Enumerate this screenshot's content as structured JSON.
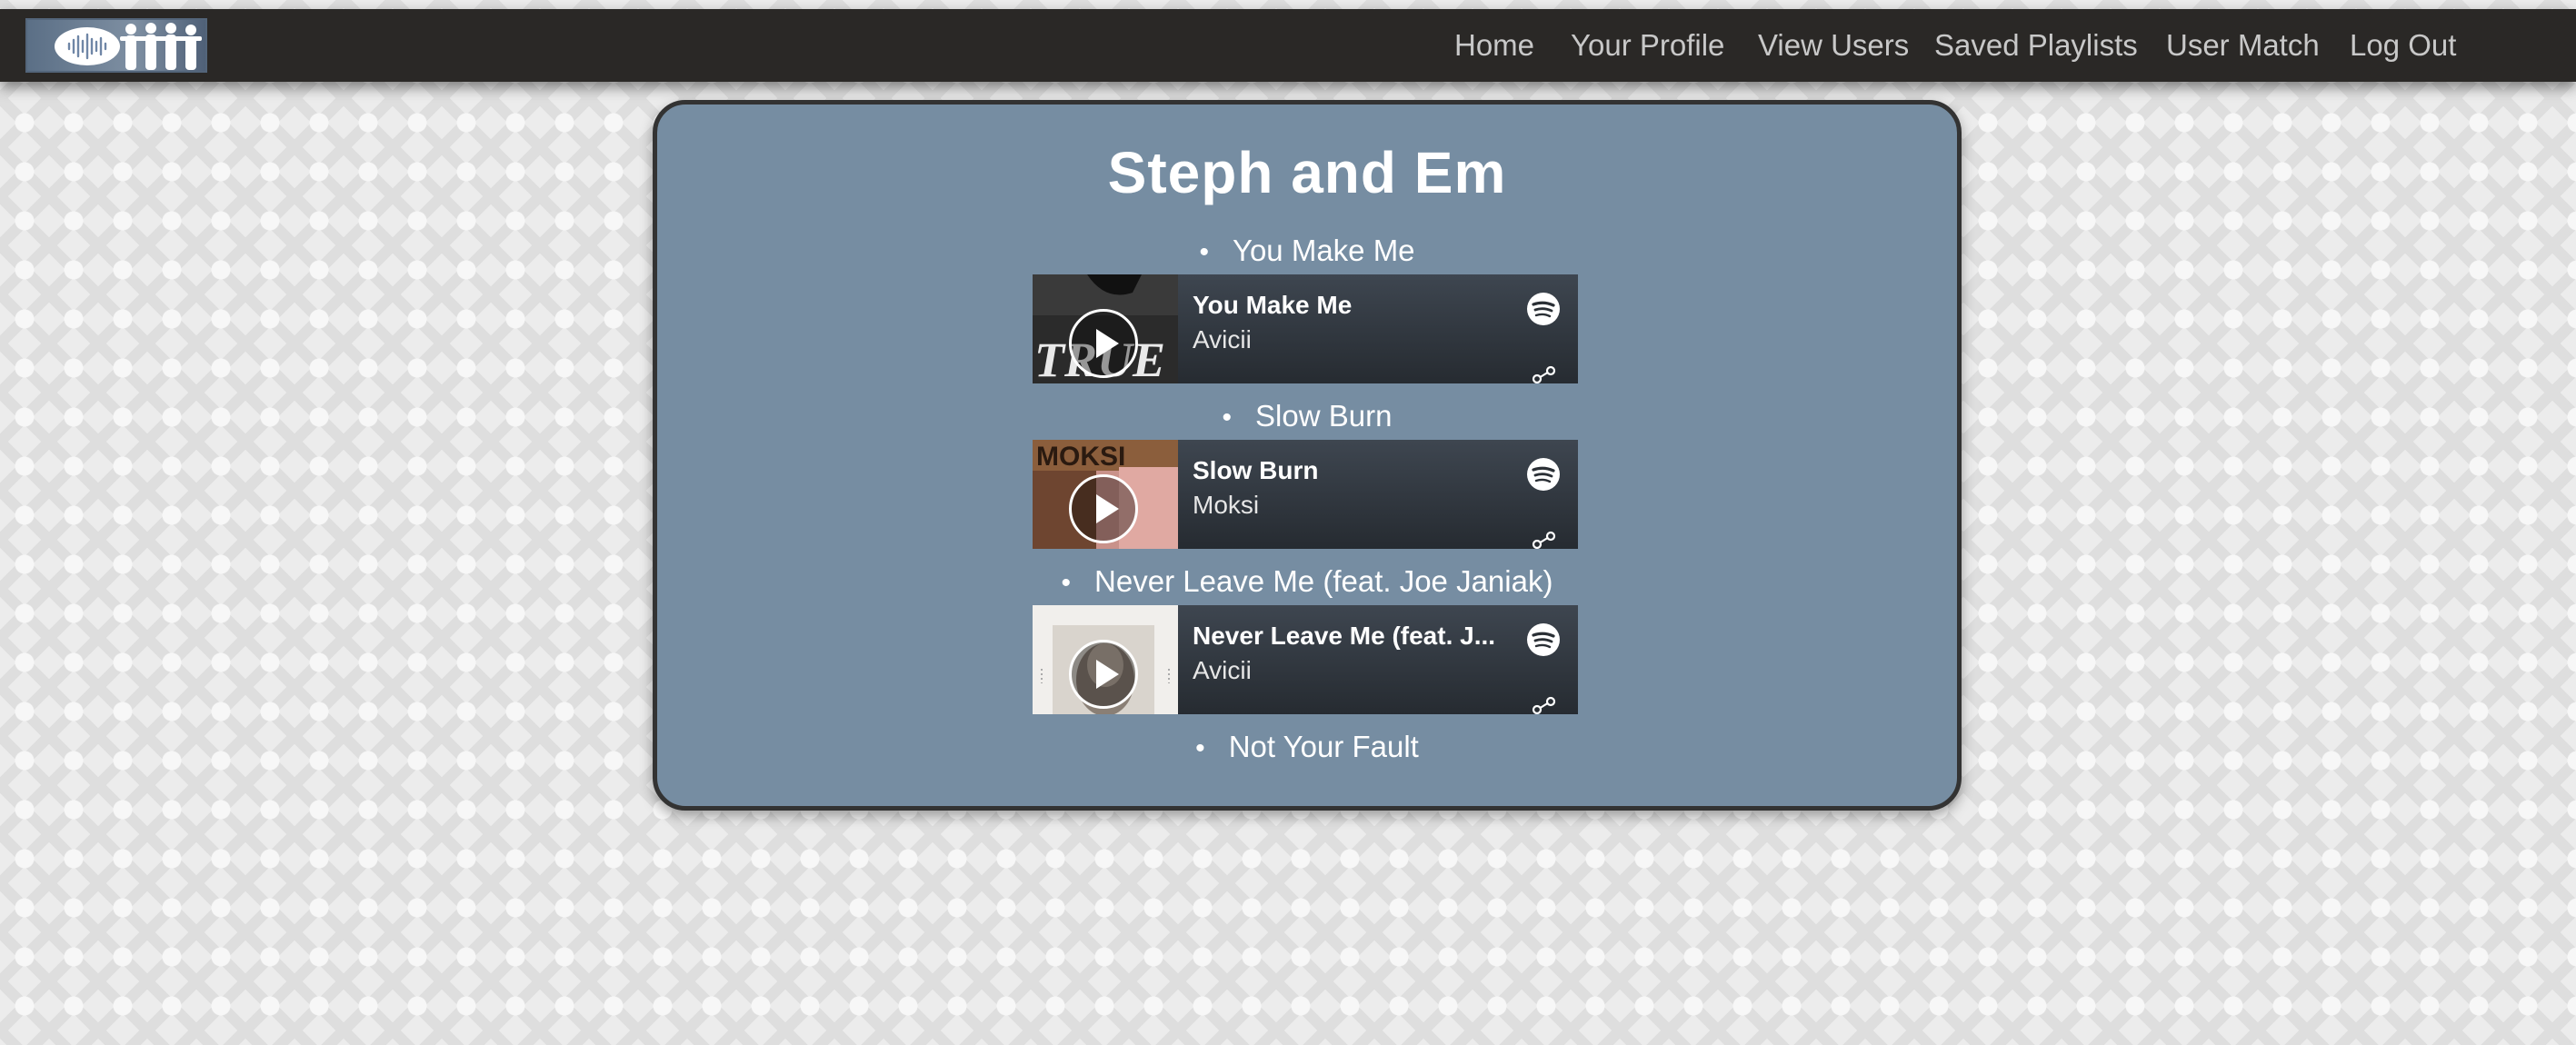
{
  "nav": {
    "logo_icon": "soundwave-people-logo",
    "items": [
      "Home",
      "Your Profile",
      "View Users",
      "Saved Playlists",
      "User Match",
      "Log Out"
    ]
  },
  "playlist": {
    "title": "Steph and Em",
    "songs": [
      {
        "label": "You Make Me",
        "embed": {
          "track": "You Make Me",
          "artist": "Avicii"
        }
      },
      {
        "label": "Slow Burn",
        "embed": {
          "track": "Slow Burn",
          "artist": "Moksi"
        }
      },
      {
        "label": "Never Leave Me (feat. Joe Janiak)",
        "embed": {
          "track": "Never Leave Me (feat. J...",
          "artist": "Avicii"
        }
      },
      {
        "label": "Not Your Fault"
      }
    ]
  },
  "icons": {
    "bullet": "•",
    "play": "play-icon",
    "spotify": "spotify-icon",
    "share": "share-icon"
  },
  "colors": {
    "navbar": "#2a2826",
    "nav_text": "#c8c8c8",
    "card": "#768da2",
    "card_border": "#333333"
  }
}
